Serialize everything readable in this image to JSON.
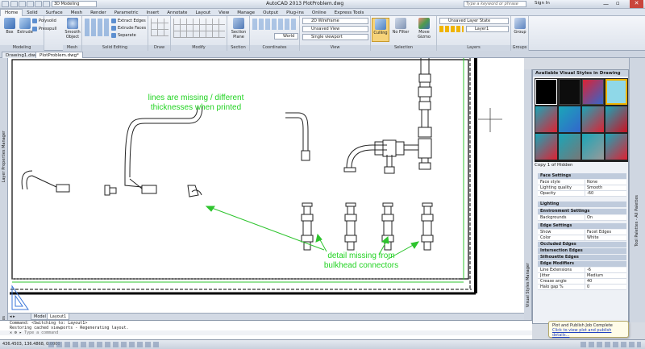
{
  "window": {
    "title": "AutoCAD 2013    PlotProblem.dwg",
    "workspace": "3D Modeling",
    "search_placeholder": "Type a keyword or phrase",
    "sign_in": "Sign In"
  },
  "ribbon": {
    "tabs": [
      "Home",
      "Solid",
      "Surface",
      "Mesh",
      "Render",
      "Parametric",
      "Insert",
      "Annotate",
      "Layout",
      "View",
      "Manage",
      "Output",
      "Plug-ins",
      "Online",
      "Express Tools"
    ],
    "active_tab": "Home",
    "panels": {
      "modeling": {
        "title": "Modeling",
        "box": "Box",
        "extrude": "Extrude",
        "polysolid": "Polysolid",
        "presspull": "Presspull"
      },
      "mesh": {
        "title": "Mesh",
        "smooth_object": "Smooth Object"
      },
      "solid_editing": {
        "title": "Solid Editing",
        "extract_edges": "Extract Edges",
        "extrude_faces": "Extrude Faces",
        "separate": "Separate"
      },
      "draw": {
        "title": "Draw"
      },
      "modify": {
        "title": "Modify"
      },
      "section": {
        "title": "Section",
        "section_plane": "Section Plane"
      },
      "coordinates": {
        "title": "Coordinates",
        "world": "World"
      },
      "view": {
        "title": "View",
        "visual_style": "2D Wireframe",
        "view_name": "Unsaved View",
        "viewport": "Single viewport"
      },
      "selection": {
        "title": "Selection",
        "culling": "Culling",
        "no_filter": "No Filter",
        "move_gizmo": "Move Gizmo"
      },
      "layers": {
        "title": "Layers",
        "layer_state": "Unsaved Layer State",
        "current_layer": "Layer1"
      },
      "groups": {
        "title": "Groups",
        "group": "Group"
      }
    }
  },
  "doc_tabs": [
    "Drawing1.dwg*",
    "PlotProblem.dwg*"
  ],
  "left_palettes": [
    "Layer Properties Manager",
    "Properties"
  ],
  "right_palettes": [
    "Tool Palettes - All Palettes"
  ],
  "canvas": {
    "annotations": {
      "top": "lines are missing / different thicknesses when printed",
      "bottom": "detail missing from bulkhead connectors"
    }
  },
  "visual_styles": {
    "header": "Available Visual Styles in Drawing",
    "current_style": "Copy 1 of Hidden",
    "palette_label": "Visual Styles Manager",
    "sections": {
      "face": "Face Settings",
      "lighting": "Lighting",
      "environment": "Environment Settings",
      "edge": "Edge Settings",
      "occluded": "Occluded Edges",
      "intersection": "Intersection Edges",
      "silhouette": "Silhouette Edges",
      "modifiers": "Edge Modifiers"
    },
    "rows": {
      "face_style": {
        "k": "Face style",
        "v": "None"
      },
      "lighting_quality": {
        "k": "Lighting quality",
        "v": "Smooth"
      },
      "opacity": {
        "k": "Opacity",
        "v": "-60"
      },
      "backgrounds": {
        "k": "Backgrounds",
        "v": "On"
      },
      "show": {
        "k": "Show",
        "v": "Facet Edges"
      },
      "color": {
        "k": "Color",
        "v": "White"
      },
      "line_extensions": {
        "k": "Line Extensions",
        "v": "-6"
      },
      "jitter": {
        "k": "Jitter",
        "v": "Medium"
      },
      "crease_angle": {
        "k": "Crease angle",
        "v": "40"
      },
      "halo_gap": {
        "k": "Halo gap %",
        "v": "0"
      }
    }
  },
  "layout_tabs": [
    "Model",
    "Layout1"
  ],
  "command": {
    "line1": "Command:  <Switching to: Layout1>",
    "line2": "Restoring cached viewports - Regenerating layout.",
    "placeholder": "Type a command"
  },
  "status": {
    "coords": "436.4503, 136.4868, 0.0000",
    "bubble_title": "Plot and Publish Job Complete",
    "bubble_link": "Click to view plot and publish details..."
  },
  "colors": {
    "annotation": "#22d322",
    "selection": "#1e8aff"
  }
}
